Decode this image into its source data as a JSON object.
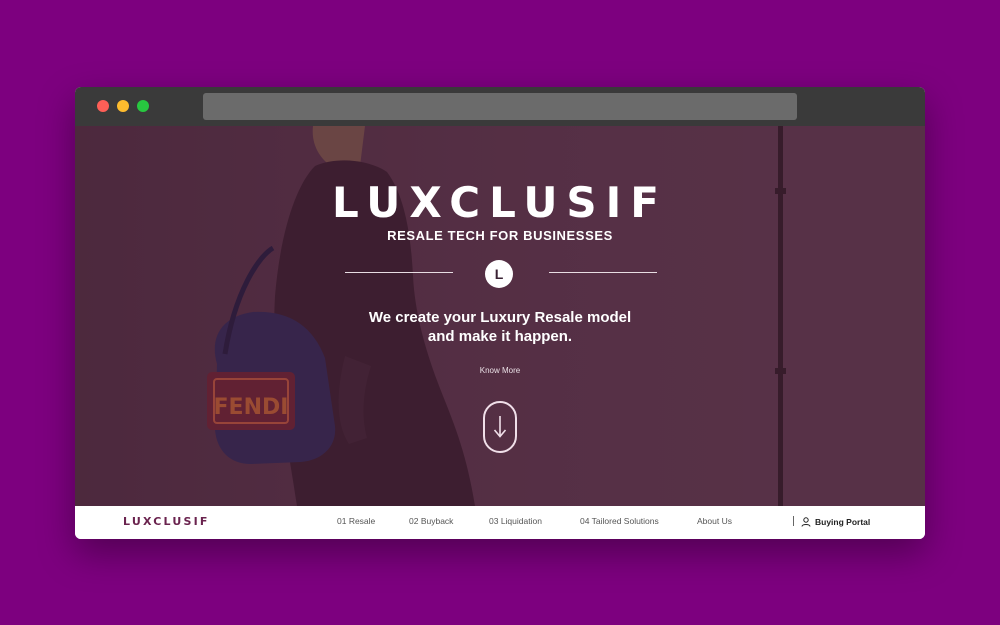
{
  "browser": {
    "address_bar": ""
  },
  "hero": {
    "brand": "LUXCLUSIF",
    "tagline": "RESALE TECH FOR BUSINESSES",
    "logo_mark": "L",
    "headline_line1": "We create your Luxury Resale model",
    "headline_line2": "and make it happen.",
    "know_more": "Know More",
    "scroll_icon": "arrow-down-icon",
    "bag_text": "FENDI"
  },
  "nav": {
    "logo": "LUXCLUSIF",
    "items": [
      {
        "label": "01 Resale"
      },
      {
        "label": "02 Buyback"
      },
      {
        "label": "03 Liquidation"
      },
      {
        "label": "04 Tailored Solutions"
      },
      {
        "label": "About Us"
      }
    ],
    "portal_label": "Buying Portal",
    "portal_icon": "user-icon"
  },
  "colors": {
    "page_background": "#7d007f",
    "brand_purple": "#6a234e",
    "hero_tint": "#523646"
  }
}
